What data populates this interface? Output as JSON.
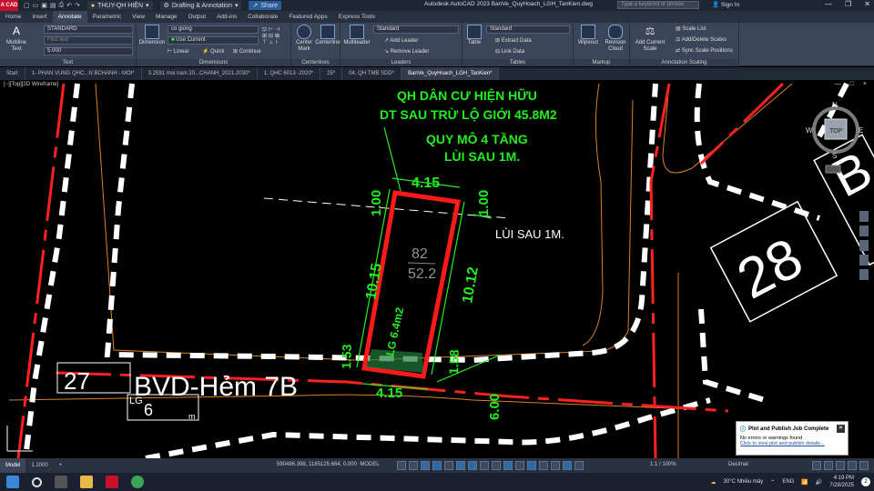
{
  "titlebar": {
    "app_logo": "A CAD",
    "workspace": "THUY-QH HIỆN",
    "workspace_mode": "Drafting & Annotation",
    "share": "Share",
    "title": "Autodesk AutoCAD 2023   BanVe_QuyHoach_LGH_TanKien.dwg",
    "search_placeholder": "Type a keyword or phrase",
    "signin": "Sign In"
  },
  "menu_tabs": [
    "Home",
    "Insert",
    "Annotate",
    "Parametric",
    "View",
    "Manage",
    "Output",
    "Add-ins",
    "Collaborate",
    "Featured Apps",
    "Express Tools"
  ],
  "active_menu_tab": "Annotate",
  "ribbon": {
    "text_panel": {
      "big_button": "Multiline Text",
      "style": "STANDARD",
      "find": "Find text",
      "height": "5.000",
      "title": "Text"
    },
    "dimensions_panel": {
      "big_button": "Dimension",
      "style": "co giong",
      "layer": "Use Current",
      "linear": "Linear",
      "quick": "Quick",
      "continue": "Continue",
      "title": "Dimensions"
    },
    "centerlines_panel": {
      "center_mark": "Center Mark",
      "centerline": "Centerline",
      "title": "Centerlines"
    },
    "leaders_panel": {
      "big_button": "Multileader",
      "style": "Standard",
      "add": "Add Leader",
      "remove": "Remove Leader",
      "title": "Leaders"
    },
    "tables_panel": {
      "big_button": "Table",
      "style": "Standard",
      "extract": "Extract Data",
      "link": "Link Data",
      "title": "Tables"
    },
    "markup_panel": {
      "wipeout": "Wipeout",
      "revision": "Revision Cloud",
      "title": "Markup"
    },
    "scaling_panel": {
      "add": "Add Current Scale",
      "list": "Scale List",
      "add_delete": "Add/Delete Scales",
      "sync": "Sync Scale Positions",
      "title": "Annotation Scaling"
    }
  },
  "file_tabs": [
    "Start",
    "1- PHAN VUNG QHC...N BCHANH - MOI*",
    "3.2591 moi nam 20...CHANH_2021-2030*",
    "1. QHC 6013 -2020*",
    "25*",
    "04. QH TMB SDD*",
    "BanVe_QuyHoach_LGH_TanKien*"
  ],
  "active_file_tab": "BanVe_QuyHoach_LGH_TanKien*",
  "viewport": {
    "label": "[−][Top][2D Wireframe]",
    "controls": "— □ ×"
  },
  "drawing": {
    "title1": "QH DÂN CƯ HIỆN HỮU",
    "title2": "DT SAU TRỪ LỘ GIỚI 45.8M2",
    "note1": "QUY MÔ 4 TẦNG",
    "note2": "LÙI SAU 1M.",
    "setback_label": "LÙI SAU 1M.",
    "dim_top": "4.15",
    "dim_bottom": "4.15",
    "dim_left_top": "1.00",
    "dim_right_top": "1.00",
    "dim_left": "10.15",
    "dim_right": "10.12",
    "dim_left_bottom": "1.53",
    "dim_right_bottom": "1.58",
    "dim_road": "6.00",
    "parcel_no": "82",
    "parcel_area": "52.2",
    "lg_label": "LG 6.4m2",
    "road_name": "BVD-Hẻm 7B",
    "block_27": "27",
    "block_28": "28",
    "block_b": "B",
    "lg_tag": "LG",
    "lg_value": "6",
    "lg_unit": "m",
    "compass": {
      "n": "N",
      "s": "S",
      "e": "E",
      "w": "W",
      "top": "TOP"
    }
  },
  "statusbar": {
    "model_tab": "Model",
    "layout_tab": "1.1000",
    "add_tab": "+",
    "coords": "590496.398, 1185125.664, 0.000",
    "mode": "MODEL",
    "scale": "1:1 / 100%",
    "units": "Decimal"
  },
  "notification": {
    "title": "Plot and Publish Job Complete",
    "line1": "No errors or warnings found",
    "link": "Click to view plot and publish details..."
  },
  "taskbar": {
    "weather": "30°C  Nhiều mây",
    "lang": "ENG",
    "time": "4:19 PM",
    "date": "7/28/2025",
    "badge": "2"
  }
}
